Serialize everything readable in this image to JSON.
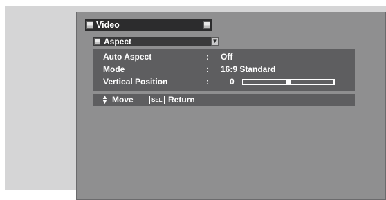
{
  "menu": {
    "title": "Video",
    "submenu": "Aspect",
    "rows": [
      {
        "label": "Auto Aspect",
        "separator": ":",
        "value": "Off"
      },
      {
        "label": "Mode",
        "separator": ":",
        "value": "16:9 Standard"
      },
      {
        "label": "Vertical Position",
        "separator": ":",
        "value": "0"
      }
    ],
    "slider_level_fraction": 0.49
  },
  "footer": {
    "move_label": "Move",
    "sel_key": "SEL",
    "return_label": "Return"
  },
  "icons": {
    "updown": "up-down-arrows-icon",
    "dropdown": "triangle-down-icon"
  },
  "colors": {
    "header_bg": "#2c2c2d",
    "panel_bg": "#5e5e60",
    "screen_bg": "#8f8f90",
    "text": "#ffffff"
  }
}
